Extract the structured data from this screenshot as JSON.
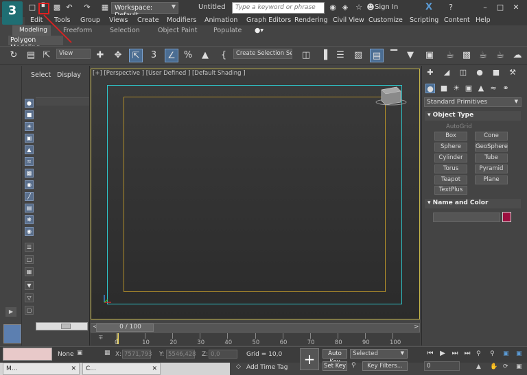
{
  "titlebar": {
    "app_logo": "3",
    "workspace": "Workspace: Default",
    "document_title": "Untitled",
    "search_placeholder": "Type a keyword or phrase",
    "signin": "Sign In",
    "icons": [
      "new-file-icon",
      "open-file-icon",
      "save-icon",
      "undo-icon",
      "redo-icon",
      "project-folder-icon"
    ]
  },
  "menu": [
    "Edit",
    "Tools",
    "Group",
    "Views",
    "Create",
    "Modifiers",
    "Animation",
    "Graph Editors",
    "Rendering",
    "Civil View",
    "Customize",
    "Scripting",
    "Content",
    "Help"
  ],
  "ribbon": {
    "tabs": [
      "Modeling",
      "Freeform",
      "Selection",
      "Object Paint",
      "Populate"
    ],
    "active_panel": "Polygon Modeling"
  },
  "toolbar": {
    "view_select": "View",
    "selection_set": "Create Selection Se"
  },
  "scene_explorer": {
    "tabs": [
      "Select",
      "Display"
    ]
  },
  "viewport": {
    "label": "[+] [Perspective ] [User Defined ] [Default Shading ]"
  },
  "timeline": {
    "slider_text": "0 / 100",
    "ticks": [
      "0",
      "10",
      "20",
      "30",
      "40",
      "50",
      "60",
      "70",
      "80",
      "90",
      "100"
    ]
  },
  "command_panel": {
    "category": "Standard Primitives",
    "object_type_title": "Object Type",
    "autogrid": "AutoGrid",
    "primitives": [
      "Box",
      "Cone",
      "Sphere",
      "GeoSphere",
      "Cylinder",
      "Tube",
      "Torus",
      "Pyramid",
      "Teapot",
      "Plane",
      "TextPlus"
    ],
    "name_color_title": "Name and Color",
    "object_color": "#9c0f3f"
  },
  "status": {
    "none_label": "None",
    "x_label": "X:",
    "x_value": "7571,793",
    "y_label": "Y:",
    "y_value": "5546,428",
    "z_label": "Z:",
    "z_value": "0,0",
    "grid": "Grid = 10,0",
    "add_time_tag": "Add Time Tag",
    "auto_key": "Auto Key",
    "set_key": "Set Key",
    "selected": "Selected",
    "key_filters": "Key Filters...",
    "frame": "0"
  },
  "taskbar": {
    "items": [
      "M...",
      "C..."
    ]
  },
  "colors": {
    "accent": "#4b6d92",
    "viewport_border": "#c8b84a",
    "safe_frame_outer": "#2ec4c8",
    "safe_frame_inner": "#b18e2a",
    "annotation": "#e02020"
  }
}
